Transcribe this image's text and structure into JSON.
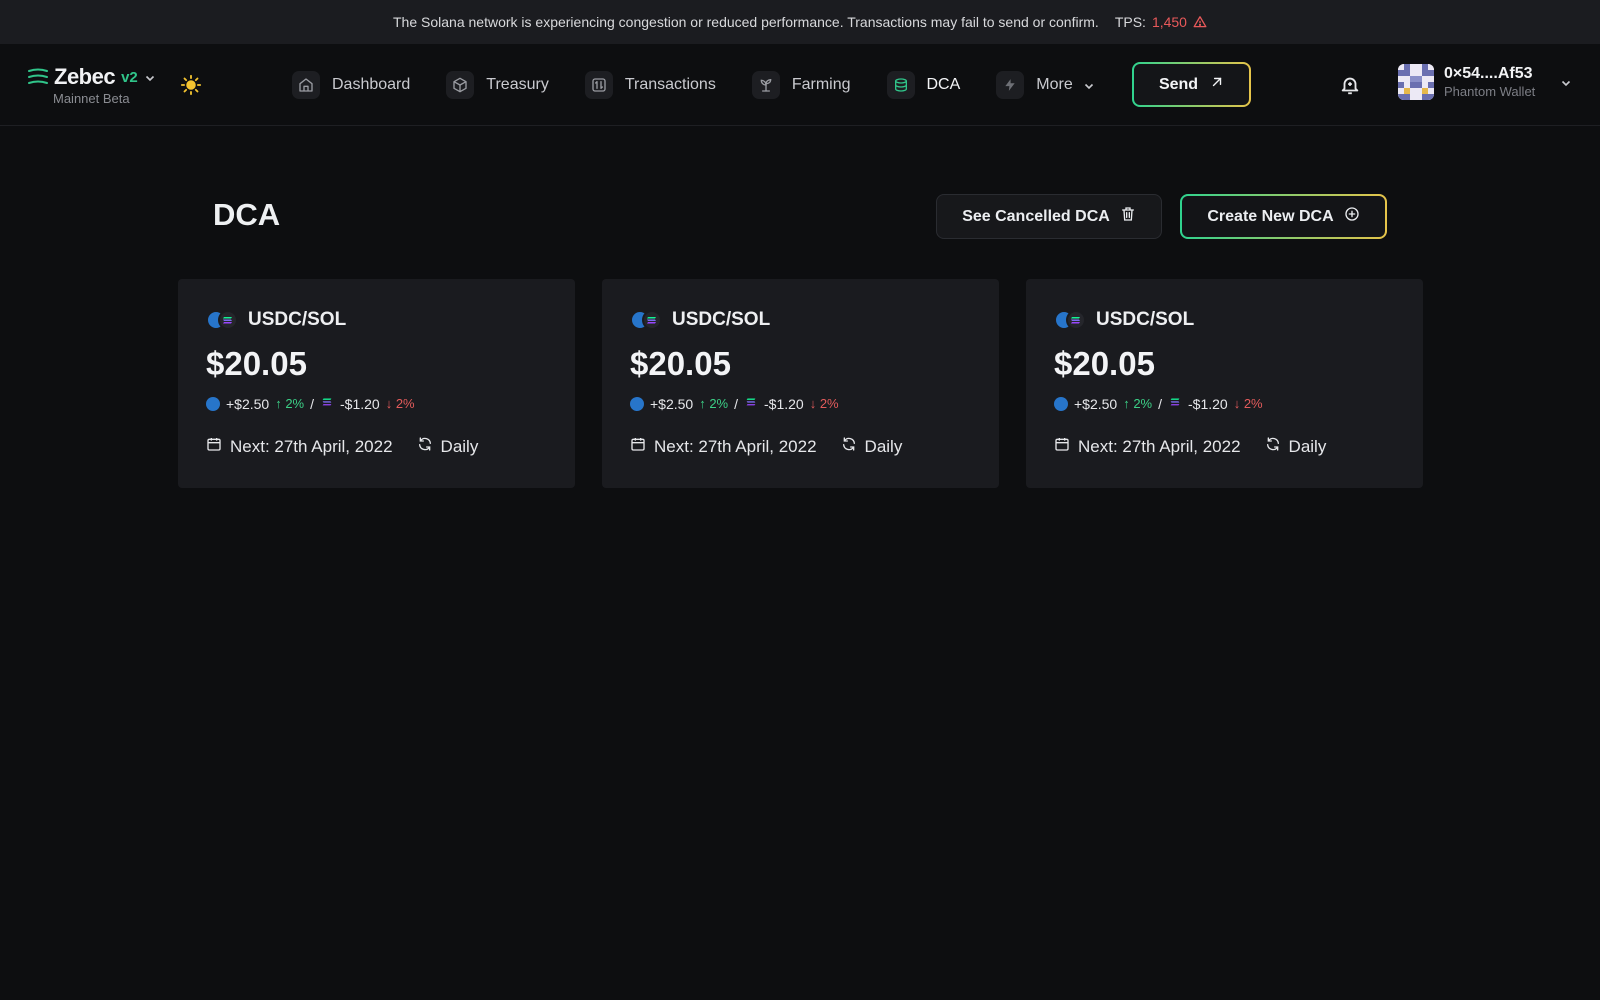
{
  "banner": {
    "message": "The Solana network is experiencing congestion or reduced performance. Transactions may fail to send or confirm.",
    "tps_label": "TPS:",
    "tps_value": "1,450"
  },
  "brand": {
    "name": "Zebec",
    "version": "v2",
    "network": "Mainnet Beta"
  },
  "nav": {
    "items": [
      {
        "label": "Dashboard",
        "icon": "home-icon"
      },
      {
        "label": "Treasury",
        "icon": "cube-icon"
      },
      {
        "label": "Transactions",
        "icon": "transfer-icon"
      },
      {
        "label": "Farming",
        "icon": "sprout-icon"
      },
      {
        "label": "DCA",
        "icon": "coins-icon",
        "active": true
      },
      {
        "label": "More",
        "icon": "bolt-icon"
      }
    ],
    "send_label": "Send"
  },
  "wallet": {
    "address": "0×54....Af53",
    "name": "Phantom Wallet"
  },
  "page": {
    "title": "DCA",
    "cancel_label": "See Cancelled DCA",
    "create_label": "Create New DCA"
  },
  "cards": [
    {
      "pair": "USDC/SOL",
      "amount": "$20.05",
      "gain": "+$2.50",
      "gain_pct": "↑ 2%",
      "sep": "/",
      "loss": "-$1.20",
      "loss_pct": "↓ 2%",
      "next": "Next: 27th April, 2022",
      "freq": "Daily"
    },
    {
      "pair": "USDC/SOL",
      "amount": "$20.05",
      "gain": "+$2.50",
      "gain_pct": "↑ 2%",
      "sep": "/",
      "loss": "-$1.20",
      "loss_pct": "↓ 2%",
      "next": "Next: 27th April, 2022",
      "freq": "Daily"
    },
    {
      "pair": "USDC/SOL",
      "amount": "$20.05",
      "gain": "+$2.50",
      "gain_pct": "↑ 2%",
      "sep": "/",
      "loss": "-$1.20",
      "loss_pct": "↓ 2%",
      "next": "Next: 27th April, 2022",
      "freq": "Daily"
    }
  ],
  "colors": {
    "accent_green": "#30c58a",
    "accent_yellow": "#e6c44a",
    "up": "#3ccf86",
    "down": "#e25b5b",
    "usdc": "#2775ca",
    "sol": "#9945ff"
  }
}
